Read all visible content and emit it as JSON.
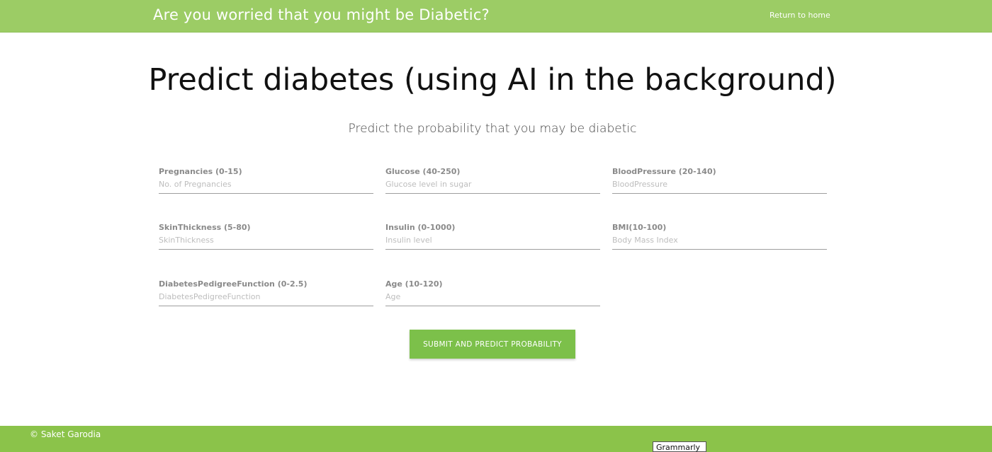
{
  "header": {
    "brand": "Are you worried that you might be Diabetic?",
    "home_link": "Return to home"
  },
  "main": {
    "title": "Predict diabetes (using AI in the background)",
    "subtitle": "Predict the probability that you may be diabetic"
  },
  "form": {
    "fields": [
      {
        "label": "Pregnancies (0-15)",
        "placeholder": "No. of Pregnancies",
        "value": ""
      },
      {
        "label": "Glucose (40-250)",
        "placeholder": "Glucose level in sugar",
        "value": ""
      },
      {
        "label": "BloodPressure (20-140)",
        "placeholder": "BloodPressure",
        "value": ""
      },
      {
        "label": "SkinThickness (5-80)",
        "placeholder": "SkinThickness",
        "value": ""
      },
      {
        "label": "Insulin (0-1000)",
        "placeholder": "Insulin level",
        "value": ""
      },
      {
        "label": "BMI(10-100)",
        "placeholder": "Body Mass Index",
        "value": ""
      },
      {
        "label": "DiabetesPedigreeFunction (0-2.5)",
        "placeholder": "DiabetesPedigreeFunction",
        "value": ""
      },
      {
        "label": "Age (10-120)",
        "placeholder": "Age",
        "value": ""
      }
    ],
    "submit_label": "SUBMIT AND PREDICT PROBABILITY"
  },
  "footer": {
    "copyright": "© Saket Garodia"
  },
  "overlay": {
    "grammarly_label": "Grammarly"
  },
  "colors": {
    "header_bg": "#9ccc65",
    "footer_bg": "#8bc34a",
    "button_bg": "#7cc04a"
  }
}
